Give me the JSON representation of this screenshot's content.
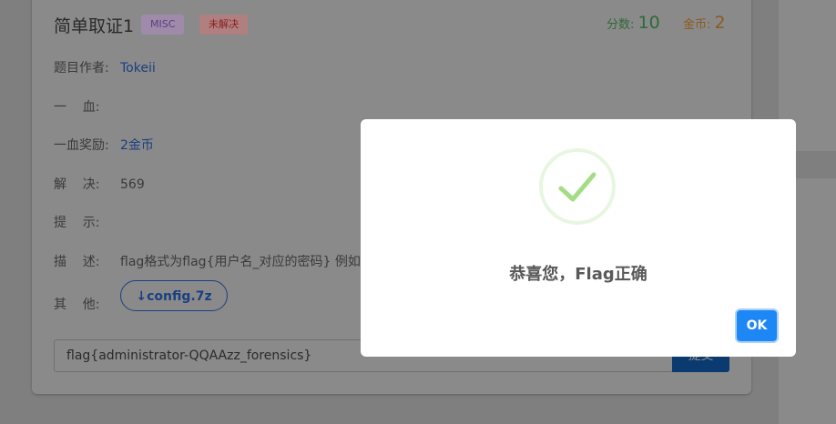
{
  "challenge": {
    "title": "简单取证1",
    "category": "MISC",
    "status": "未解决",
    "points_label": "分数:",
    "points_value": "10",
    "coins_label": "金币:",
    "coins_value": "2",
    "author_label": "题目作者:",
    "author_value": "Tokeii",
    "firstblood_label": "一    血:",
    "firstblood_value": "",
    "firstblood_reward_label": "一血奖励:",
    "firstblood_reward_value": "2金币",
    "solves_label": "解    决:",
    "solves_value": "569",
    "hint_label": "提    示:",
    "hint_value": "",
    "desc_label": "描    述:",
    "desc_value": "flag格式为flag{用户名_对应的密码} 例如",
    "other_label": "其    他:",
    "download_label": "↓config.7z"
  },
  "flag_form": {
    "input_value": "flag{administrator-QQAAzz_forensics}",
    "submit_label": "提交"
  },
  "modal": {
    "message": "恭喜您，Flag正确",
    "ok_label": "OK"
  },
  "colors": {
    "success": "#a5dc86",
    "ok_button": "#1d87f5"
  }
}
